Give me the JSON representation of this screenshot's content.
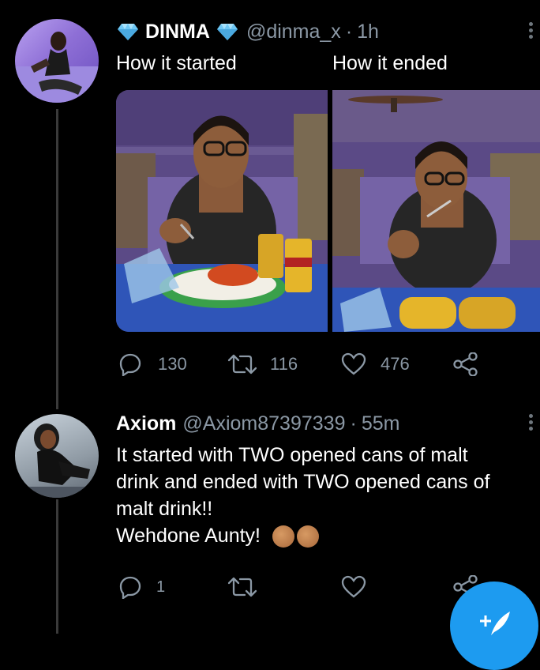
{
  "tweet1": {
    "display_name": "DINMA",
    "handle": "@dinma_x",
    "time": "1h",
    "left_caption": "How it started",
    "right_caption": "How it ended",
    "actions": {
      "replies": "130",
      "retweets": "116",
      "likes": "476"
    }
  },
  "tweet2": {
    "display_name": "Axiom",
    "handle": "@Axiom87397339",
    "time": "55m",
    "body_line1": "It started with TWO opened cans of malt",
    "body_line2": "drink and ended with TWO opened cans of",
    "body_line3": "malt drink!!",
    "body_line4": "Wehdone Aunty!",
    "actions": {
      "replies": "1",
      "retweets": "",
      "likes": ""
    }
  },
  "icons": {
    "verified_left": "diamond-icon",
    "verified_right": "diamond-icon",
    "reply": "reply-icon",
    "retweet": "retweet-icon",
    "like": "heart-icon",
    "share": "share-icon",
    "compose": "compose-icon"
  },
  "colors": {
    "background": "#000000",
    "text": "#ffffff",
    "muted": "#8b98a5",
    "accent": "#1d9bf0",
    "diamond": "#6fc8f5"
  }
}
